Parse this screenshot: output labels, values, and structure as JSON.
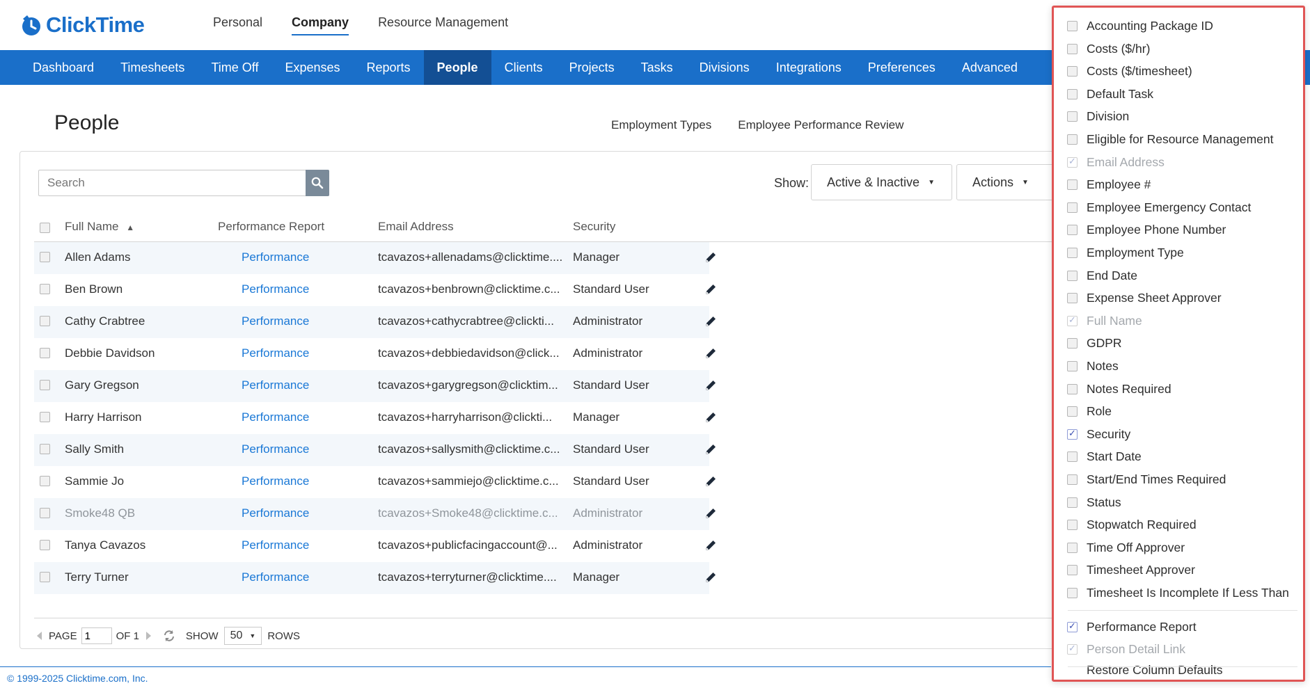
{
  "app": {
    "logo_text": "ClickTime",
    "top_nav": [
      "Personal",
      "Company",
      "Resource Management"
    ],
    "main_nav": [
      "Dashboard",
      "Timesheets",
      "Time Off",
      "Expenses",
      "Reports",
      "People",
      "Clients",
      "Projects",
      "Tasks",
      "Divisions",
      "Integrations",
      "Preferences",
      "Advanced"
    ]
  },
  "page": {
    "title": "People",
    "sublinks": [
      "Employment Types",
      "Employee Performance Review"
    ]
  },
  "toolbar": {
    "search_placeholder": "Search",
    "show_label": "Show:",
    "show_value": "Active & Inactive",
    "actions_label": "Actions",
    "caret": "▼"
  },
  "table": {
    "headers": {
      "full_name": "Full Name",
      "sort_arrow": "▲",
      "performance": "Performance Report",
      "email": "Email Address",
      "security": "Security"
    },
    "rows": [
      {
        "name": "Allen Adams",
        "perf": "Performance",
        "email": "tcavazos+allenadams@clicktime....",
        "security": "Manager",
        "muted": false
      },
      {
        "name": "Ben Brown",
        "perf": "Performance",
        "email": "tcavazos+benbrown@clicktime.c...",
        "security": "Standard User",
        "muted": false
      },
      {
        "name": "Cathy Crabtree",
        "perf": "Performance",
        "email": "tcavazos+cathycrabtree@clickti...",
        "security": "Administrator",
        "muted": false
      },
      {
        "name": "Debbie Davidson",
        "perf": "Performance",
        "email": "tcavazos+debbiedavidson@click...",
        "security": "Administrator",
        "muted": false
      },
      {
        "name": "Gary Gregson",
        "perf": "Performance",
        "email": "tcavazos+garygregson@clicktim...",
        "security": "Standard User",
        "muted": false
      },
      {
        "name": "Harry Harrison",
        "perf": "Performance",
        "email": "tcavazos+harryharrison@clickti...",
        "security": "Manager",
        "muted": false
      },
      {
        "name": "Sally Smith",
        "perf": "Performance",
        "email": "tcavazos+sallysmith@clicktime.c...",
        "security": "Standard User",
        "muted": false
      },
      {
        "name": "Sammie Jo",
        "perf": "Performance",
        "email": "tcavazos+sammiejo@clicktime.c...",
        "security": "Standard User",
        "muted": false
      },
      {
        "name": "Smoke48 QB",
        "perf": "Performance",
        "email": "tcavazos+Smoke48@clicktime.c...",
        "security": "Administrator",
        "muted": true
      },
      {
        "name": "Tanya Cavazos",
        "perf": "Performance",
        "email": "tcavazos+publicfacingaccount@...",
        "security": "Administrator",
        "muted": false
      },
      {
        "name": "Terry Turner",
        "perf": "Performance",
        "email": "tcavazos+terryturner@clicktime....",
        "security": "Manager",
        "muted": false
      }
    ]
  },
  "pager": {
    "page_label": "PAGE",
    "page_value": "1",
    "of_label": "OF 1",
    "show_label": "SHOW",
    "rows_value": "50",
    "rows_label": "ROWS",
    "caret": "▼"
  },
  "footer": {
    "copyright": "© 1999-2025 Clicktime.com, Inc."
  },
  "columns_menu": {
    "items": [
      {
        "label": "Accounting Package ID",
        "checked": false,
        "disabled": false
      },
      {
        "label": "Costs ($/hr)",
        "checked": false,
        "disabled": false
      },
      {
        "label": "Costs ($/timesheet)",
        "checked": false,
        "disabled": false
      },
      {
        "label": "Default Task",
        "checked": false,
        "disabled": false
      },
      {
        "label": "Division",
        "checked": false,
        "disabled": false
      },
      {
        "label": "Eligible for Resource Management",
        "checked": false,
        "disabled": false
      },
      {
        "label": "Email Address",
        "checked": true,
        "disabled": true
      },
      {
        "label": "Employee #",
        "checked": false,
        "disabled": false
      },
      {
        "label": "Employee Emergency Contact",
        "checked": false,
        "disabled": false
      },
      {
        "label": "Employee Phone Number",
        "checked": false,
        "disabled": false
      },
      {
        "label": "Employment Type",
        "checked": false,
        "disabled": false
      },
      {
        "label": "End Date",
        "checked": false,
        "disabled": false
      },
      {
        "label": "Expense Sheet Approver",
        "checked": false,
        "disabled": false
      },
      {
        "label": "Full Name",
        "checked": true,
        "disabled": true
      },
      {
        "label": "GDPR",
        "checked": false,
        "disabled": false
      },
      {
        "label": "Notes",
        "checked": false,
        "disabled": false
      },
      {
        "label": "Notes Required",
        "checked": false,
        "disabled": false
      },
      {
        "label": "Role",
        "checked": false,
        "disabled": false
      },
      {
        "label": "Security",
        "checked": true,
        "disabled": false
      },
      {
        "label": "Start Date",
        "checked": false,
        "disabled": false
      },
      {
        "label": "Start/End Times Required",
        "checked": false,
        "disabled": false
      },
      {
        "label": "Status",
        "checked": false,
        "disabled": false
      },
      {
        "label": "Stopwatch Required",
        "checked": false,
        "disabled": false
      },
      {
        "label": "Time Off Approver",
        "checked": false,
        "disabled": false
      },
      {
        "label": "Timesheet Approver",
        "checked": false,
        "disabled": false
      },
      {
        "label": "Timesheet Is Incomplete If Less Than",
        "checked": false,
        "disabled": false
      }
    ],
    "extra_items": [
      {
        "label": "Performance Report",
        "checked": true,
        "disabled": false
      },
      {
        "label": "Person Detail Link",
        "checked": true,
        "disabled": true
      }
    ],
    "restore_label": "Restore Column Defaults"
  },
  "colors": {
    "brand": "#1a6fc9",
    "nav_active": "#134f94",
    "link": "#1a78d6",
    "popup_border": "#e05555"
  }
}
